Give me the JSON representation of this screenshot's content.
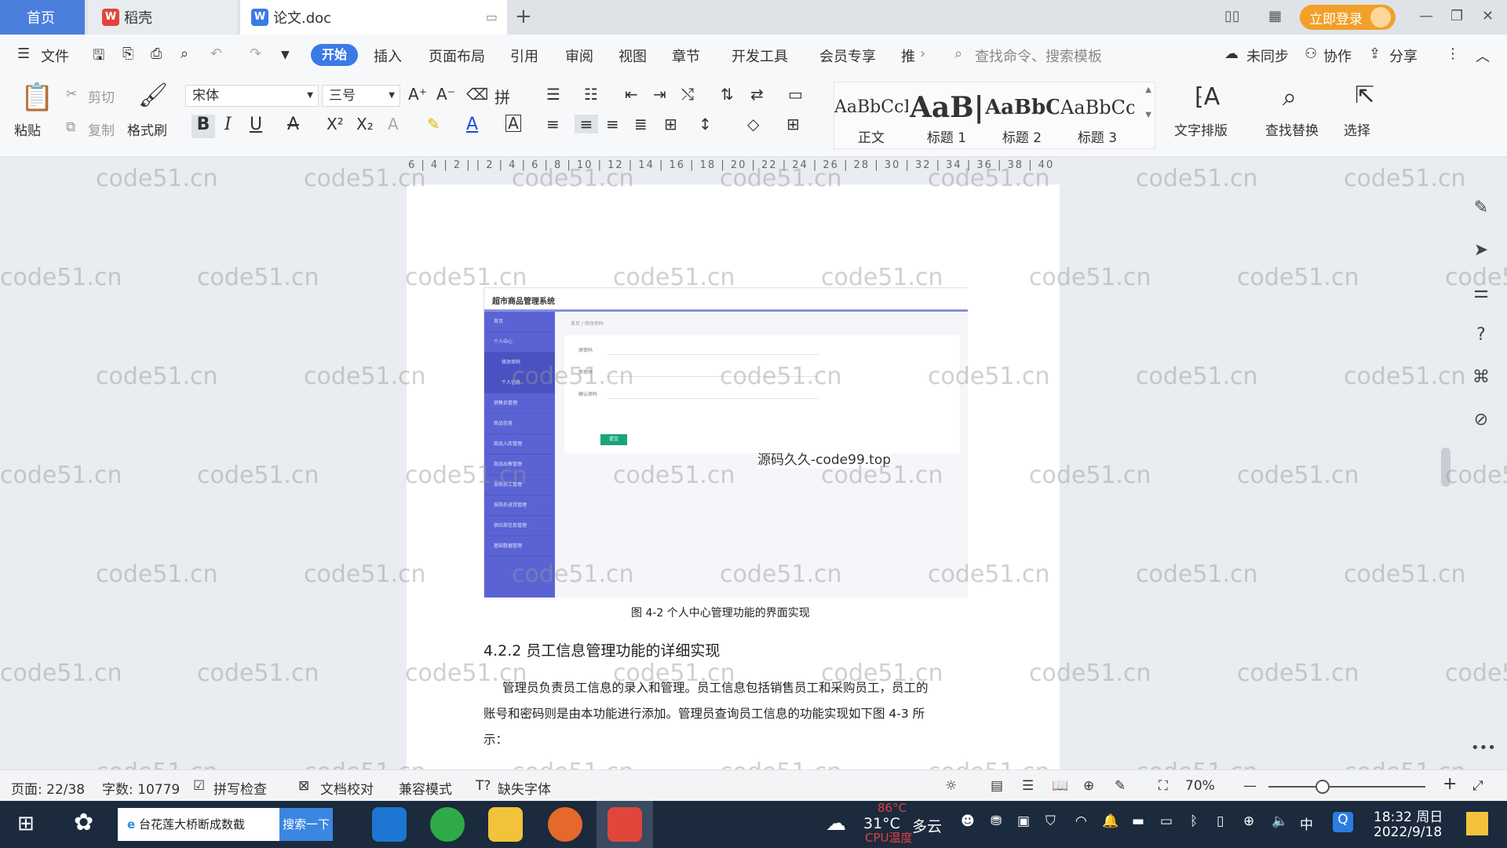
{
  "titlebar": {
    "tabs": [
      {
        "label": "首页"
      },
      {
        "label": "稻壳"
      },
      {
        "label": "论文.doc"
      }
    ],
    "login_label": "立即登录"
  },
  "menubar": {
    "items": [
      "文件",
      "开始",
      "插入",
      "页面布局",
      "引用",
      "审阅",
      "视图",
      "章节",
      "开发工具",
      "会员专享",
      "推"
    ],
    "search_command": "查找命令、搜索模板",
    "right": [
      "未同步",
      "协作",
      "分享"
    ]
  },
  "ribbon": {
    "paste": "粘贴",
    "cut": "剪切",
    "copy": "复制",
    "format_painter": "格式刷",
    "font_name": "宋体",
    "font_size": "三号",
    "styles": [
      {
        "sample": "AaBbCcI",
        "label": "正文"
      },
      {
        "sample": "AaB|",
        "label": "标题 1"
      },
      {
        "sample": "AaBbC",
        "label": "标题 2"
      },
      {
        "sample": "AaBbCc",
        "label": "标题 3"
      }
    ],
    "text_layout": "文字排版",
    "find_replace": "查找替换",
    "select": "选择"
  },
  "ruler": {
    "ticks": "6 | 4 | 2 |   | 2 | 4 | 6 | 8 | 10 | 12 | 14 | 16 | 18 | 20 | 22 | 24 | 26 | 28 | 30 | 32 | 34 | 36 | 38 | 40"
  },
  "watermark": "code51.cn",
  "document": {
    "figure": {
      "app_title": "超市商品管理系统",
      "breadcrumb": "首页 / 修改密码",
      "sidebar": [
        "首页",
        "个人中心",
        "修改密码",
        "个人信息",
        "销售员管理",
        "商品信息",
        "商品入库管理",
        "商品出售管理",
        "采购员工管理",
        "采购员进货管理",
        "供应商信息管理",
        "基础数据管理"
      ],
      "form_labels": [
        "原密码",
        "新密码",
        "确认密码"
      ],
      "submit": "提交",
      "overlay": "源码久久-code99.top"
    },
    "caption": "图 4-2 个人中心管理功能的界面实现",
    "heading": "4.2.2 员工信息管理功能的详细实现",
    "paragraph": [
      "管理员负责员工信息的录入和管理。员工信息包括销售员工和采购员工，员工的",
      "账号和密码则是由本功能进行添加。管理员查询员工信息的功能实现如下图 4-3 所",
      "示："
    ]
  },
  "statusbar": {
    "page": "页面: 22/38",
    "words": "字数: 10779",
    "spell": "拼写检查",
    "proof": "文档校对",
    "compat": "兼容模式",
    "missing_font": "缺失字体",
    "zoom": "70%"
  },
  "taskbar": {
    "search_text": "台花莲大桥断成数截",
    "search_button": "搜索一下",
    "weather_temp": "31°C",
    "weather_desc": "多云",
    "cpu_temp": "86°C",
    "cpu_label": "CPU温度",
    "ime": "中",
    "time": "18:32 周日",
    "date": "2022/9/18"
  },
  "colors": {
    "accent": "#3b7ae6",
    "login": "#f1a02a",
    "figure_sidebar": "#5b63d4",
    "taskbar": "#1b2a3d"
  }
}
